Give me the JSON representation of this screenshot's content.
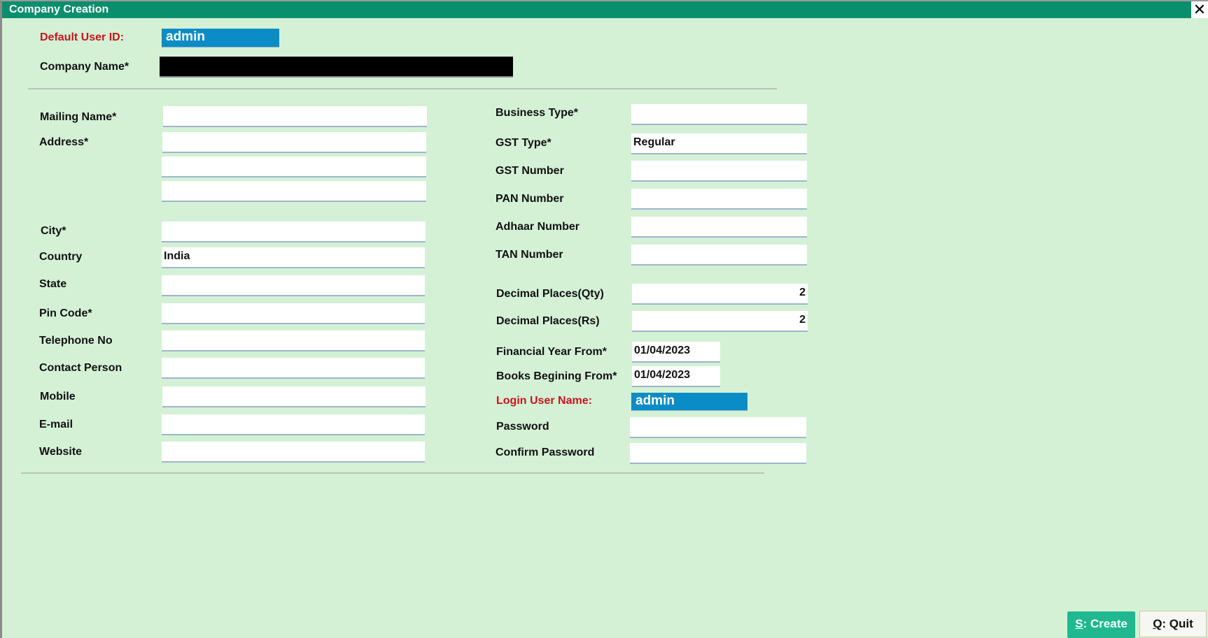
{
  "window": {
    "title": "Company Creation",
    "close_icon": "close-icon"
  },
  "header": {
    "default_user_id_label": "Default User ID:",
    "default_user_id_value": "admin",
    "company_name_label": "Company Name*",
    "company_name_value": ""
  },
  "left": {
    "mailing_name": {
      "label": "Mailing Name*",
      "value": ""
    },
    "address": {
      "label": "Address*",
      "lines": [
        "",
        "",
        ""
      ]
    },
    "city": {
      "label": "City*",
      "value": ""
    },
    "country": {
      "label": "Country",
      "value": "India"
    },
    "state": {
      "label": "State",
      "value": ""
    },
    "pin_code": {
      "label": "Pin Code*",
      "value": ""
    },
    "telephone": {
      "label": "Telephone No",
      "value": ""
    },
    "contact_person": {
      "label": "Contact Person",
      "value": ""
    },
    "mobile": {
      "label": "Mobile",
      "value": ""
    },
    "email": {
      "label": "E-mail",
      "value": ""
    },
    "website": {
      "label": "Website",
      "value": ""
    }
  },
  "right": {
    "business_type": {
      "label": "Business Type*",
      "value": ""
    },
    "gst_type": {
      "label": "GST Type*",
      "value": "Regular"
    },
    "gst_number": {
      "label": "GST Number",
      "value": ""
    },
    "pan_number": {
      "label": "PAN Number",
      "value": ""
    },
    "adhaar_number": {
      "label": "Adhaar Number",
      "value": ""
    },
    "tan_number": {
      "label": "TAN Number",
      "value": ""
    },
    "decimal_qty": {
      "label": "Decimal Places(Qty)",
      "value": "2"
    },
    "decimal_rs": {
      "label": "Decimal Places(Rs)",
      "value": "2"
    },
    "fy_from": {
      "label": "Financial Year From*",
      "value": "01/04/2023"
    },
    "books_from": {
      "label": "Books Begining From*",
      "value": "01/04/2023"
    },
    "login_user": {
      "label": "Login User Name:",
      "value": "admin"
    },
    "password": {
      "label": "Password",
      "value": ""
    },
    "confirm_password": {
      "label": "Confirm Password",
      "value": ""
    }
  },
  "buttons": {
    "create_hotkey": "S",
    "create_label": ": Create",
    "quit_hotkey": "Q",
    "quit_label": ": Quit"
  },
  "colors": {
    "titlebar": "#0a8f6c",
    "background": "#d4f1d6",
    "highlight_field": "#0a8cc6",
    "required_red": "#c4161c",
    "create_button": "#1fb88f"
  }
}
